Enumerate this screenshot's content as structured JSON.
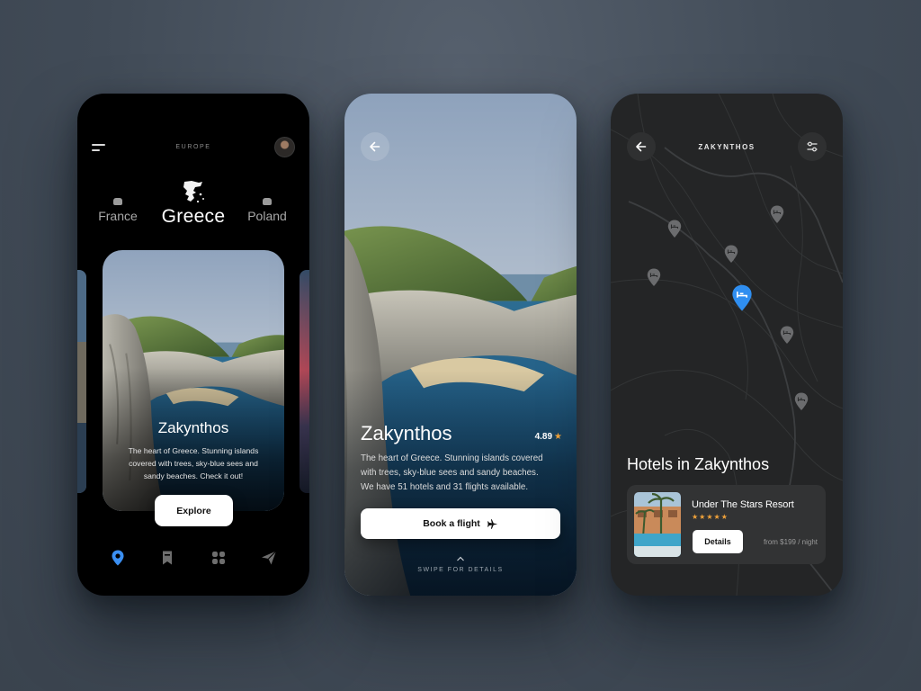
{
  "explore_screen": {
    "region": "EUROPE",
    "countries": {
      "left": "France",
      "main": "Greece",
      "right": "Poland"
    },
    "card": {
      "title": "Zakynthos",
      "description": "The heart of Greece. Stunning islands covered with trees, sky-blue sees and sandy beaches. Check it out!",
      "button": "Explore"
    },
    "nav": [
      "location-pin-icon",
      "bookmark-icon",
      "apps-icon",
      "paper-plane-icon"
    ],
    "accent": "#3b8ff2"
  },
  "detail_screen": {
    "title": "Zakynthos",
    "rating": "4.89",
    "description": "The heart of Greece. Stunning islands covered with trees, sky-blue sees and sandy beaches. We have 51 hotels and 31 flights available.",
    "button": "Book a flight",
    "hint": "SWIPE FOR DETAILS",
    "star_color": "#f0a23a"
  },
  "map_screen": {
    "title": "ZAKYNTHOS",
    "heading": "Hotels in Zakynthos",
    "hotel": {
      "name": "Under The Stars Resort",
      "stars": "★★★★★",
      "button": "Details",
      "price": "from $199 / night"
    },
    "pin_active_color": "#2f8ef0",
    "pin_color": "#6b6c6e"
  }
}
